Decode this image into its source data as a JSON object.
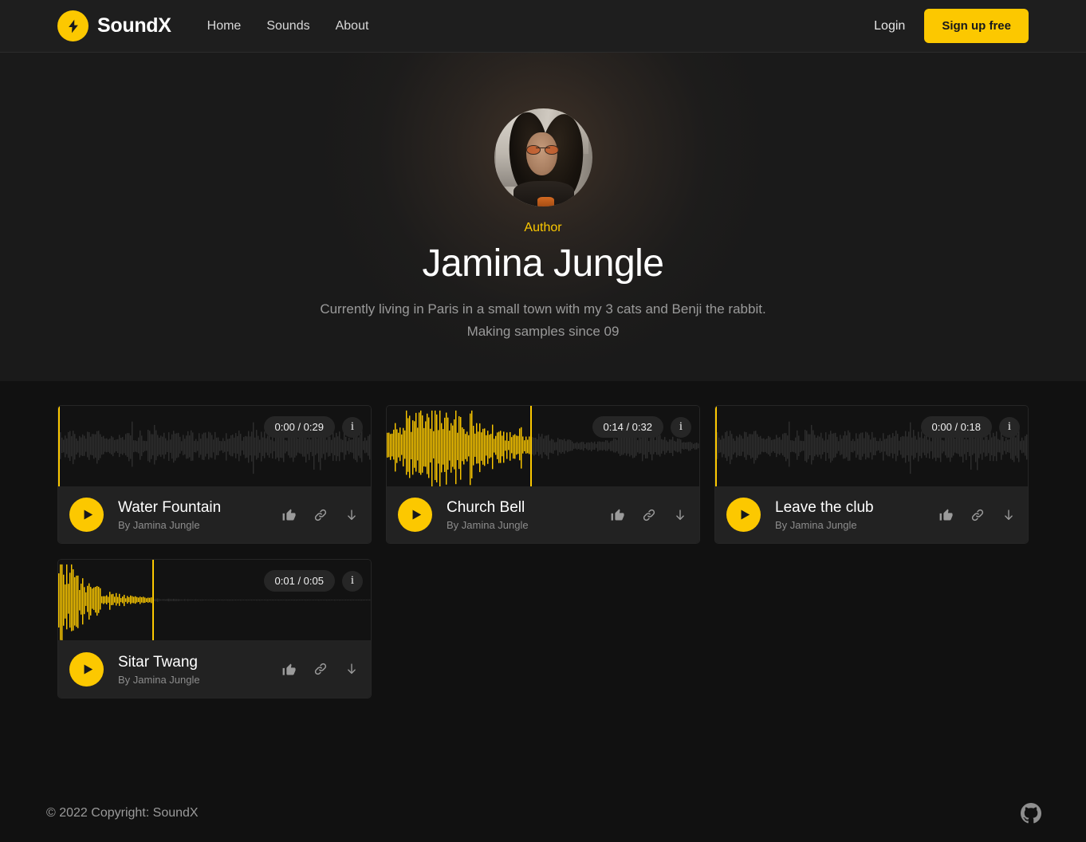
{
  "brand": {
    "name": "SoundX",
    "logo_icon": "lightning-bolt-icon",
    "accent_color": "#fcc800"
  },
  "nav": {
    "links": [
      {
        "label": "Home"
      },
      {
        "label": "Sounds"
      },
      {
        "label": "About"
      }
    ],
    "login_label": "Login",
    "signup_label": "Sign up free"
  },
  "hero": {
    "avatar_alt": "Jamina Jungle profile photo",
    "kicker": "Author",
    "title": "Jamina Jungle",
    "bio": "Currently living in Paris in a small town with my 3 cats and Benji the rabbit. Making samples since 09"
  },
  "sounds": {
    "action_icons": [
      "thumbs-up-icon",
      "link-icon",
      "download-icon"
    ],
    "info_label": "i",
    "cards": [
      {
        "title": "Water Fountain",
        "author": "By Jamina Jungle",
        "time_display": "0:00 / 0:29",
        "current_time": "0:00",
        "duration": "0:29",
        "progress_percent": 0,
        "waveform_style": "noisy-ambient"
      },
      {
        "title": "Church Bell",
        "author": "By Jamina Jungle",
        "time_display": "0:14 / 0:32",
        "current_time": "0:14",
        "duration": "0:32",
        "progress_percent": 46,
        "waveform_style": "loud-bell"
      },
      {
        "title": "Leave the club",
        "author": "By Jamina Jungle",
        "time_display": "0:00 / 0:18",
        "current_time": "0:00",
        "duration": "0:18",
        "progress_percent": 0,
        "waveform_style": "noisy-ambient"
      },
      {
        "title": "Sitar Twang",
        "author": "By Jamina Jungle",
        "time_display": "0:01 / 0:05",
        "current_time": "0:01",
        "duration": "0:05",
        "progress_percent": 30,
        "waveform_style": "decaying-pluck"
      }
    ]
  },
  "footer": {
    "copyright": "© 2022 Copyright: SoundX",
    "social_icon": "github-icon"
  }
}
